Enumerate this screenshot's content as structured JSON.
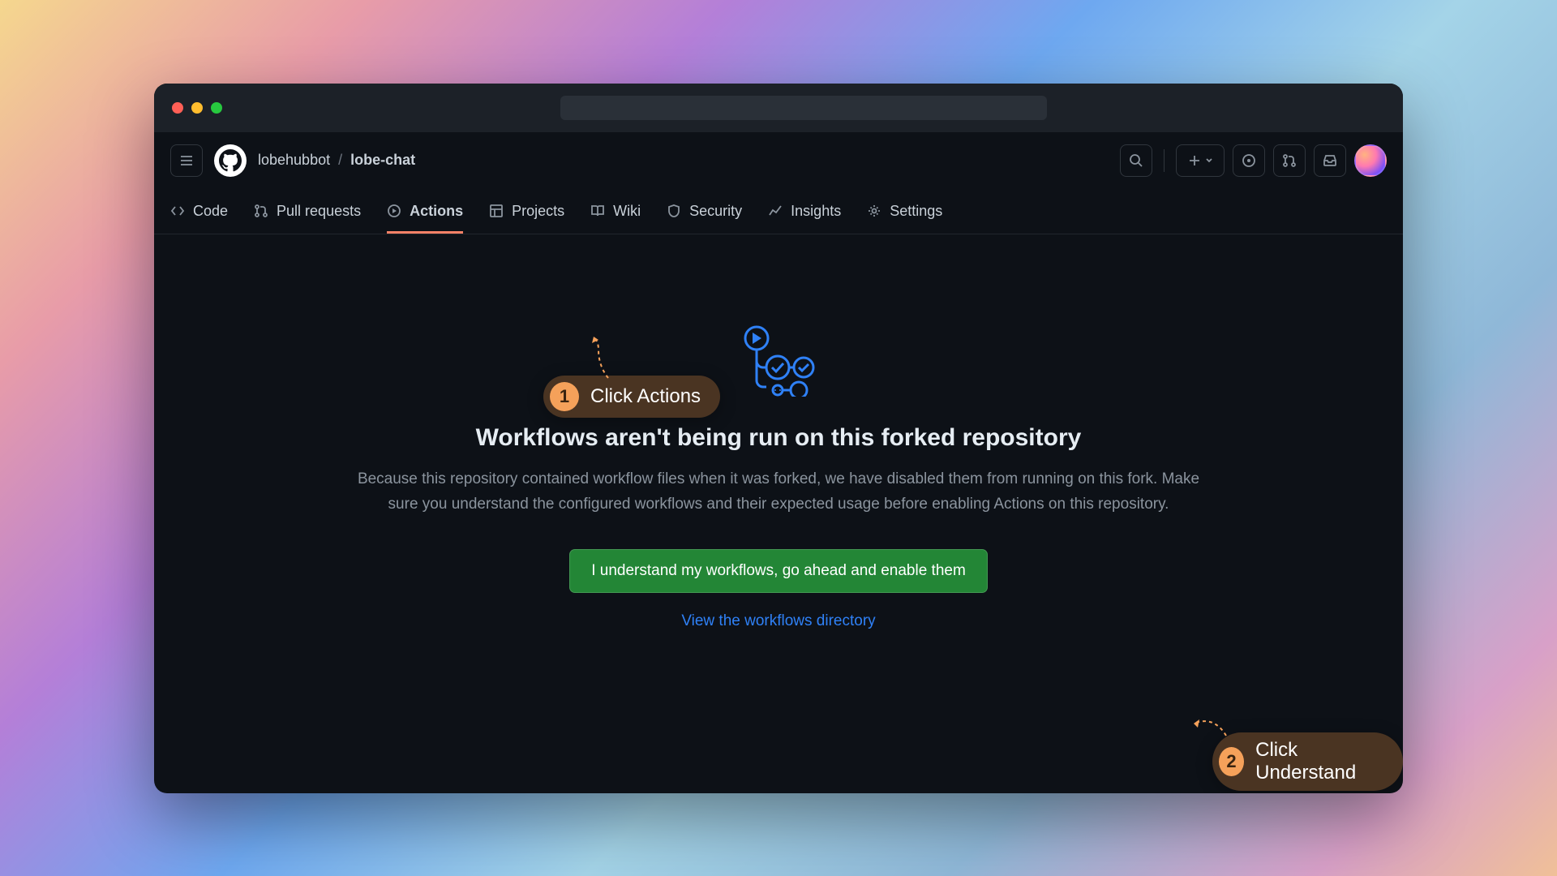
{
  "breadcrumb": {
    "owner": "lobehubbot",
    "repo": "lobe-chat"
  },
  "tabs": [
    {
      "label": "Code"
    },
    {
      "label": "Pull requests"
    },
    {
      "label": "Actions"
    },
    {
      "label": "Projects"
    },
    {
      "label": "Wiki"
    },
    {
      "label": "Security"
    },
    {
      "label": "Insights"
    },
    {
      "label": "Settings"
    }
  ],
  "main": {
    "heading": "Workflows aren't being run on this forked repository",
    "description": "Because this repository contained workflow files when it was forked, we have disabled them from running on this fork. Make sure you understand the configured workflows and their expected usage before enabling Actions on this repository.",
    "enable_button": "I understand my workflows, go ahead and enable them",
    "view_link": "View the workflows directory"
  },
  "callouts": {
    "step1": {
      "num": "1",
      "text": "Click Actions"
    },
    "step2": {
      "num": "2",
      "text": "Click Understand"
    }
  }
}
